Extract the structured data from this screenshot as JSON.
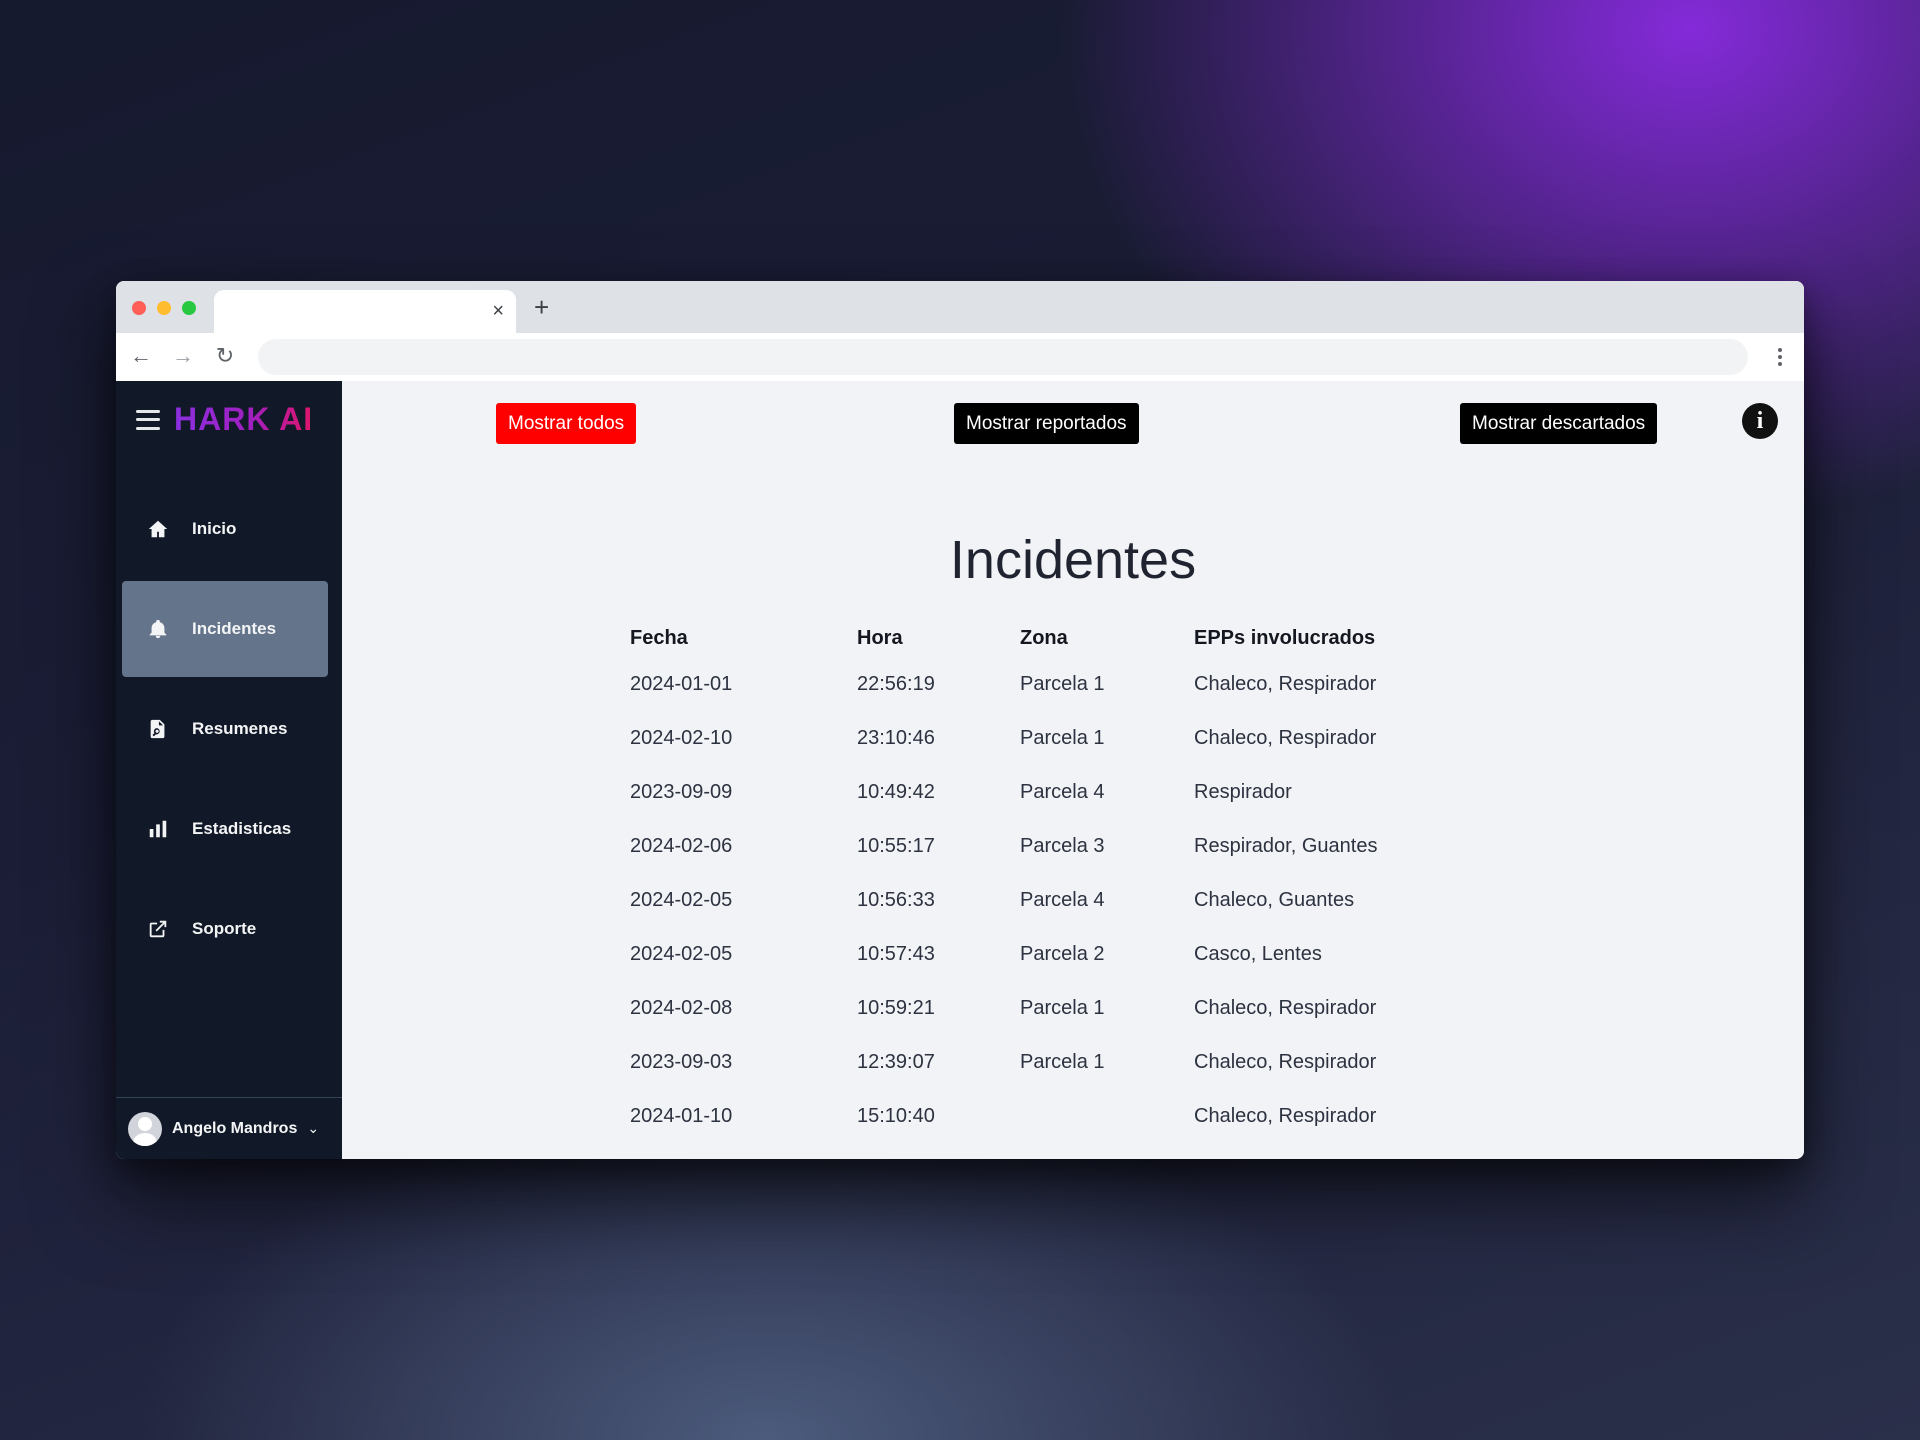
{
  "browser": {
    "tab_close": "×",
    "new_tab": "+",
    "back": "←",
    "forward": "→",
    "reload": "↻"
  },
  "sidebar": {
    "logo": "HARK AI",
    "items": [
      {
        "label": "Inicio",
        "icon": "home-icon"
      },
      {
        "label": "Incidentes",
        "icon": "bell-icon",
        "active": true
      },
      {
        "label": "Resumenes",
        "icon": "document-search-icon"
      },
      {
        "label": "Estadisticas",
        "icon": "bar-chart-icon"
      },
      {
        "label": "Soporte",
        "icon": "external-link-icon"
      }
    ],
    "user": {
      "name": "Angelo Mandros",
      "chevron": "⌄"
    }
  },
  "toolbar": {
    "show_all": "Mostrar todos",
    "show_reported": "Mostrar reportados",
    "show_discarded": "Mostrar descartados",
    "info": "i"
  },
  "main": {
    "title": "Incidentes",
    "table": {
      "headers": [
        "Fecha",
        "Hora",
        "Zona",
        "EPPs involucrados"
      ],
      "rows": [
        [
          "2024-01-01",
          "22:56:19",
          "Parcela 1",
          "Chaleco, Respirador"
        ],
        [
          "2024-02-10",
          "23:10:46",
          "Parcela 1",
          "Chaleco, Respirador"
        ],
        [
          "2023-09-09",
          "10:49:42",
          "Parcela 4",
          "Respirador"
        ],
        [
          "2024-02-06",
          "10:55:17",
          "Parcela 3",
          "Respirador, Guantes"
        ],
        [
          "2024-02-05",
          "10:56:33",
          "Parcela 4",
          "Chaleco, Guantes"
        ],
        [
          "2024-02-05",
          "10:57:43",
          "Parcela 2",
          "Casco, Lentes"
        ],
        [
          "2024-02-08",
          "10:59:21",
          "Parcela 1",
          "Chaleco, Respirador"
        ],
        [
          "2023-09-03",
          "12:39:07",
          "Parcela 1",
          "Chaleco, Respirador"
        ],
        [
          "2024-01-10",
          "15:10:40",
          "",
          "Chaleco, Respirador"
        ]
      ]
    }
  },
  "colors": {
    "sidebar_bg": "#111827",
    "active_item_bg": "#64748b",
    "show_all_bg": "#ff0000",
    "button_dark_bg": "#000000"
  }
}
